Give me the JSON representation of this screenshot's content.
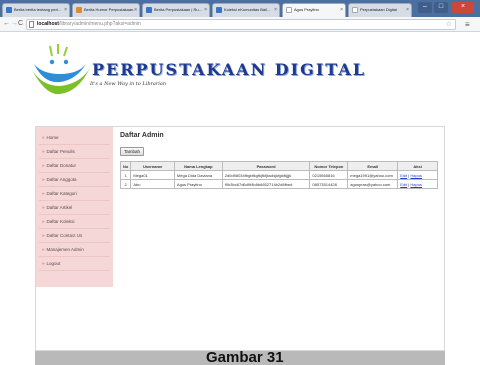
{
  "browser": {
    "tabs": [
      {
        "label": "Berita berita tentang perl..."
      },
      {
        "label": "Berita Humor Perpustakaan..."
      },
      {
        "label": "Berita Perpustakaan | Ru..."
      },
      {
        "label": "Koleksi eKomunitas Bali..."
      },
      {
        "label": "Agus Prayitno"
      },
      {
        "label": "Perpustakaan Digital"
      }
    ],
    "url_host": "localhost",
    "url_path": "/library/admin/menu.php?aksi=admin"
  },
  "header": {
    "brand": "PERPUSTAKAAN DIGITAL",
    "tagline": "It's a New Way in to Librarian"
  },
  "sidebar": {
    "items": [
      {
        "label": "Home"
      },
      {
        "label": "Daftar Penulis"
      },
      {
        "label": "Daftar Donatur"
      },
      {
        "label": "Daftar Anggota"
      },
      {
        "label": "Daftar Kategori"
      },
      {
        "label": "Daftar Artikel"
      },
      {
        "label": "Daftar Koleksi"
      },
      {
        "label": "Daftar Contact Us"
      },
      {
        "label": "Manajemen Admin"
      },
      {
        "label": "Logout"
      }
    ]
  },
  "main": {
    "title": "Daftar Admin",
    "add_button": "Tambah",
    "table": {
      "headers": [
        "No",
        "Username",
        "Nama Lengkap",
        "Password",
        "Nomor Telepon",
        "Email",
        "Aksi"
      ],
      "rows": [
        {
          "no": "1",
          "username": "Mega01",
          "name": "Mega Dida Daviana",
          "password": "2d0d98034fbgbfkgfkjfkfjksdsjkfgkfkjjjk",
          "phone": "0215565816",
          "email": "mega1991@yahoo.com",
          "edit": "Edit",
          "delete": "Hapus"
        },
        {
          "no": "2",
          "username": "Abu",
          "name": "Agus Prayitno",
          "password": "f0b3bc67d6d9f4b8b6652714b2d8fbed",
          "phone": "08573514428",
          "email": "aguspras@yahoo.com",
          "edit": "Edit",
          "delete": "Hapus"
        }
      ]
    }
  },
  "caption": "Gambar 31"
}
